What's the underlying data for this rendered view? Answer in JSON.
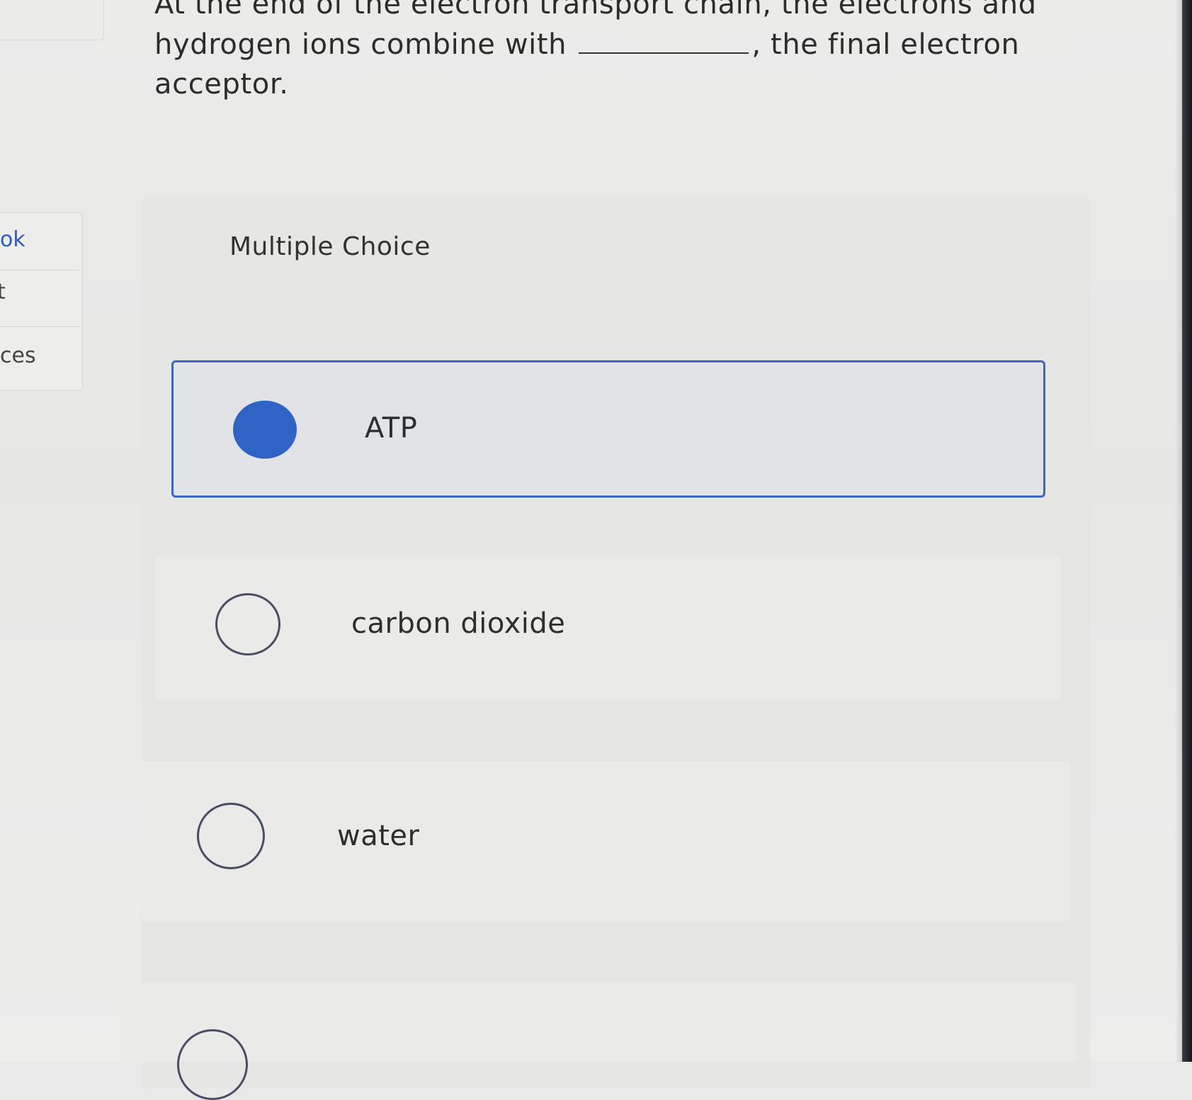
{
  "question": {
    "text_before_blank": "At the end of the electron transport chain, the electrons and hydrogen ions combine with",
    "text_after_blank": ", the final electron acceptor."
  },
  "sidebar": {
    "items": [
      {
        "label": "ok"
      },
      {
        "label": "t"
      },
      {
        "label": "ces"
      }
    ]
  },
  "quiz": {
    "type_label": "Multiple Choice",
    "options": [
      {
        "label": "ATP",
        "selected": true
      },
      {
        "label": "carbon dioxide",
        "selected": false
      },
      {
        "label": "water",
        "selected": false
      },
      {
        "label": "",
        "selected": false
      }
    ]
  },
  "colors": {
    "accent": "#2f64c5",
    "selected_border": "#3b66c4",
    "radio_border": "#4a4d63",
    "background": "#e9e9e9"
  }
}
